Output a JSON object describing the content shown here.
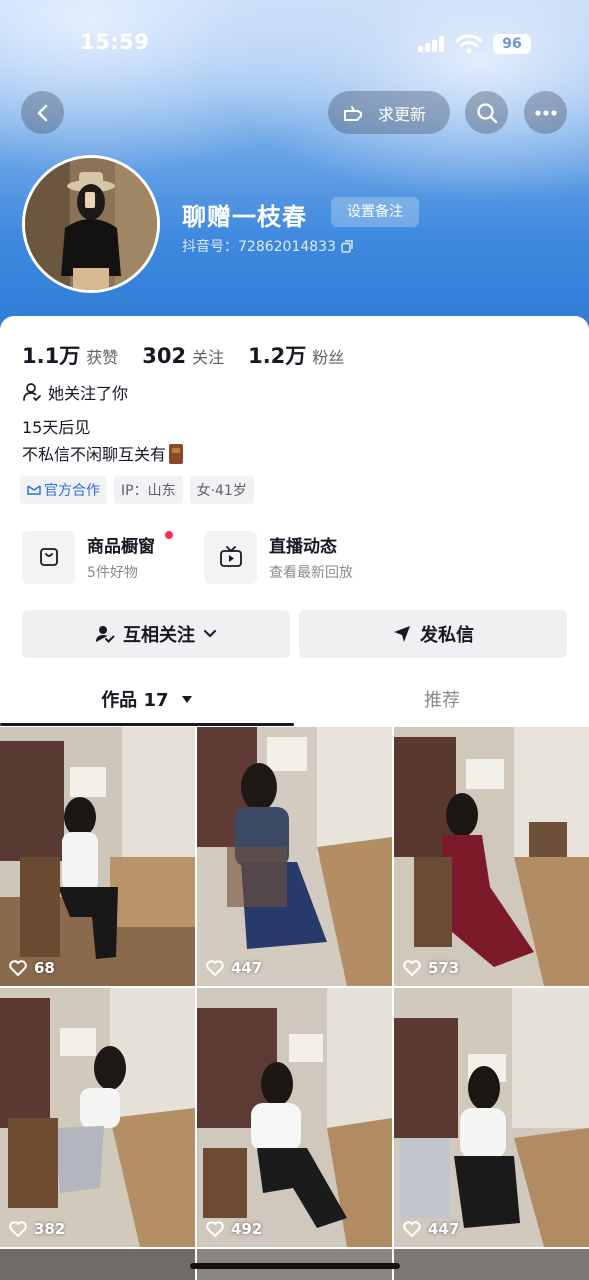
{
  "status_bar": {
    "time": "15:59",
    "battery": "96"
  },
  "header": {
    "update_button": "求更新",
    "nickname": "聊赠一枝春",
    "remark_button": "设置备注",
    "douyin_id": "抖音号：72862014833"
  },
  "stats": [
    {
      "num": "1.1万",
      "label": "获赞"
    },
    {
      "num": "302",
      "label": "关注"
    },
    {
      "num": "1.2万",
      "label": "粉丝"
    }
  ],
  "follows_you": "她关注了你",
  "bio": {
    "line1": "15天后见",
    "line2": "不私信不闲聊互关有"
  },
  "tags": {
    "official": "官方合作",
    "ip": "IP：山东",
    "gender_age": "女·41岁"
  },
  "shortcuts": {
    "shop": {
      "title": "商品橱窗",
      "subtitle": "5件好物"
    },
    "live": {
      "title": "直播动态",
      "subtitle": "查看最新回放"
    }
  },
  "actions": {
    "mutual_follow": "互相关注",
    "message": "发私信"
  },
  "tabs": {
    "works": "作品 17",
    "recommend": "推荐"
  },
  "videos": [
    {
      "likes": "68"
    },
    {
      "likes": "447"
    },
    {
      "likes": "573"
    },
    {
      "likes": "382"
    },
    {
      "likes": "492"
    },
    {
      "likes": "447"
    }
  ],
  "colors": {
    "accent": "#fe2c55",
    "header_blue": "#3e89de",
    "official_blue": "#2b6fe6"
  }
}
